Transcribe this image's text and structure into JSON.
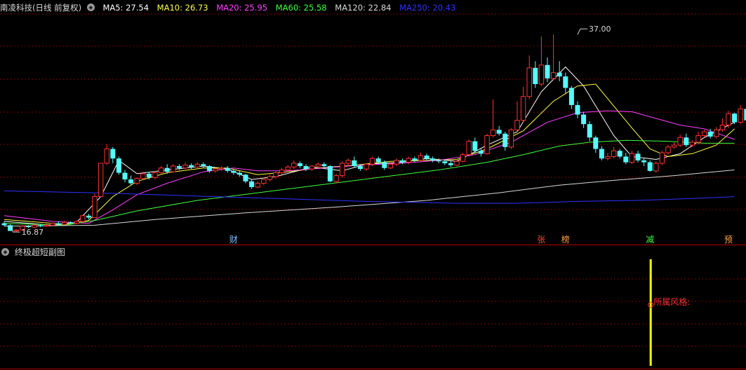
{
  "header": {
    "stock_title": "南凌科技(日线 前复权)",
    "ma": [
      {
        "label": "MA5: 27.54",
        "color": "#ffffff"
      },
      {
        "label": "MA10: 26.73",
        "color": "#ffff40"
      },
      {
        "label": "MA20: 25.95",
        "color": "#ff40ff"
      },
      {
        "label": "MA60: 25.58",
        "color": "#40ff40"
      },
      {
        "label": "MA120: 22.84",
        "color": "#d8d8d8"
      },
      {
        "label": "MA250: 20.43",
        "color": "#3030ff"
      }
    ]
  },
  "subchart": {
    "title": "终极超短副图",
    "style_label": "所属风格:"
  },
  "colors": {
    "up": "#ff3232",
    "down": "#54ffff",
    "grid": "#800000",
    "yellow_bar": "#ffff00",
    "style_text": "#ff3030"
  },
  "markers": [
    {
      "label": "财",
      "index": 38,
      "color": "#7ec0ff"
    },
    {
      "label": "张",
      "index": 89,
      "color": "#ff4040"
    },
    {
      "label": "榜",
      "index": 93,
      "color": "#ffa040"
    },
    {
      "label": "减",
      "index": 107,
      "color": "#40ff40"
    },
    {
      "label": "预",
      "index": 120,
      "color": "#ffa040"
    }
  ],
  "chart_data": {
    "type": "candlestick",
    "price_annotations": [
      {
        "label": "37.00",
        "value": 37.0,
        "index": 95
      },
      {
        "label": "16.87",
        "value": 16.87,
        "index": 1
      }
    ],
    "candles": [
      [
        17.2,
        17.0,
        17.4,
        16.9
      ],
      [
        17.0,
        16.4,
        17.1,
        16.4
      ],
      [
        16.4,
        16.5,
        16.6,
        16.3
      ],
      [
        16.5,
        16.9,
        17.0,
        16.4
      ],
      [
        16.9,
        16.8,
        17.0,
        16.7
      ],
      [
        16.8,
        17.0,
        17.1,
        16.7
      ],
      [
        17.0,
        16.9,
        17.1,
        16.8
      ],
      [
        16.9,
        17.0,
        17.2,
        16.8
      ],
      [
        17.0,
        17.2,
        17.3,
        16.9
      ],
      [
        17.2,
        17.1,
        17.4,
        17.0
      ],
      [
        17.1,
        17.3,
        17.5,
        17.0
      ],
      [
        17.3,
        17.2,
        17.4,
        17.1
      ],
      [
        17.2,
        17.4,
        17.5,
        17.1
      ],
      [
        17.4,
        18.0,
        18.1,
        17.3
      ],
      [
        18.0,
        17.8,
        18.2,
        17.6
      ],
      [
        17.8,
        20.0,
        20.3,
        17.8
      ],
      [
        20.0,
        23.5,
        23.5,
        20.0
      ],
      [
        23.5,
        25.0,
        25.5,
        23.3
      ],
      [
        25.0,
        24.0,
        25.2,
        23.5
      ],
      [
        24.0,
        22.5,
        24.2,
        22.3
      ],
      [
        22.5,
        21.8,
        22.8,
        21.5
      ],
      [
        21.8,
        21.4,
        22.2,
        21.2
      ],
      [
        21.4,
        21.9,
        22.0,
        21.2
      ],
      [
        21.9,
        22.4,
        22.6,
        21.7
      ],
      [
        22.4,
        22.0,
        22.6,
        21.8
      ],
      [
        22.0,
        22.5,
        22.7,
        21.8
      ],
      [
        22.5,
        23.0,
        23.2,
        22.3
      ],
      [
        23.0,
        22.6,
        23.4,
        22.4
      ],
      [
        22.6,
        23.2,
        23.4,
        22.5
      ],
      [
        23.2,
        23.0,
        23.4,
        22.8
      ],
      [
        23.0,
        23.3,
        23.6,
        22.9
      ],
      [
        23.3,
        23.1,
        23.5,
        22.9
      ],
      [
        23.1,
        23.4,
        23.6,
        23.0
      ],
      [
        23.4,
        23.2,
        23.6,
        23.0
      ],
      [
        23.2,
        22.7,
        23.3,
        22.5
      ],
      [
        22.7,
        22.9,
        23.0,
        22.5
      ],
      [
        22.9,
        23.0,
        23.2,
        22.7
      ],
      [
        23.0,
        22.7,
        23.2,
        22.5
      ],
      [
        22.7,
        22.5,
        22.9,
        22.3
      ],
      [
        22.5,
        22.3,
        22.7,
        22.1
      ],
      [
        22.3,
        21.6,
        22.4,
        21.4
      ],
      [
        21.6,
        21.0,
        21.8,
        20.8
      ],
      [
        21.0,
        21.4,
        21.6,
        20.9
      ],
      [
        21.4,
        21.8,
        22.0,
        21.2
      ],
      [
        21.8,
        22.1,
        22.3,
        21.6
      ],
      [
        22.1,
        22.5,
        22.7,
        21.9
      ],
      [
        22.5,
        22.8,
        23.0,
        22.3
      ],
      [
        22.8,
        23.1,
        23.3,
        22.6
      ],
      [
        23.1,
        23.5,
        23.8,
        22.9
      ],
      [
        23.5,
        23.2,
        23.7,
        23.0
      ],
      [
        23.2,
        22.9,
        23.4,
        22.7
      ],
      [
        22.9,
        23.2,
        23.3,
        22.7
      ],
      [
        23.2,
        23.4,
        23.6,
        23.0
      ],
      [
        23.4,
        23.2,
        23.6,
        23.0
      ],
      [
        23.2,
        21.6,
        23.3,
        21.5
      ],
      [
        21.6,
        22.2,
        22.4,
        21.4
      ],
      [
        22.2,
        23.5,
        23.7,
        22.0
      ],
      [
        23.5,
        23.8,
        24.0,
        23.2
      ],
      [
        23.8,
        23.2,
        24.2,
        23.0
      ],
      [
        23.2,
        22.9,
        23.4,
        22.7
      ],
      [
        22.9,
        23.4,
        23.5,
        22.7
      ],
      [
        23.4,
        24.0,
        24.2,
        23.2
      ],
      [
        24.0,
        23.6,
        24.2,
        23.4
      ],
      [
        23.6,
        23.0,
        23.8,
        22.8
      ],
      [
        23.0,
        23.4,
        23.6,
        22.9
      ],
      [
        23.4,
        23.8,
        24.0,
        23.2
      ],
      [
        23.8,
        23.6,
        24.0,
        23.4
      ],
      [
        23.6,
        24.0,
        24.2,
        23.4
      ],
      [
        24.0,
        23.8,
        24.2,
        23.6
      ],
      [
        23.8,
        24.3,
        24.6,
        23.7
      ],
      [
        24.3,
        24.0,
        24.5,
        23.8
      ],
      [
        24.0,
        23.8,
        24.2,
        23.6
      ],
      [
        23.8,
        23.7,
        24.0,
        23.5
      ],
      [
        23.7,
        23.5,
        23.9,
        23.3
      ],
      [
        23.5,
        23.3,
        23.7,
        23.1
      ],
      [
        23.3,
        23.7,
        23.9,
        23.2
      ],
      [
        23.7,
        24.4,
        24.6,
        23.6
      ],
      [
        24.4,
        25.8,
        26.0,
        24.2
      ],
      [
        25.8,
        24.8,
        26.2,
        24.6
      ],
      [
        24.8,
        24.5,
        25.0,
        24.2
      ],
      [
        24.5,
        26.4,
        26.6,
        24.4
      ],
      [
        26.4,
        27.0,
        30.2,
        26.2
      ],
      [
        27.0,
        26.6,
        27.4,
        26.4
      ],
      [
        26.6,
        25.2,
        26.8,
        24.8
      ],
      [
        25.2,
        27.0,
        27.2,
        25.0
      ],
      [
        27.0,
        28.0,
        30.0,
        26.8
      ],
      [
        28.0,
        30.5,
        31.5,
        27.8
      ],
      [
        30.5,
        33.5,
        34.8,
        30.2
      ],
      [
        33.5,
        31.8,
        34.2,
        31.4
      ],
      [
        31.8,
        33.8,
        36.8,
        31.6
      ],
      [
        33.8,
        32.4,
        34.6,
        32.0
      ],
      [
        32.4,
        33.0,
        37.0,
        32.2
      ],
      [
        33.0,
        32.6,
        34.2,
        32.1
      ],
      [
        32.6,
        31.4,
        33.0,
        30.8
      ],
      [
        31.4,
        29.6,
        31.6,
        29.2
      ],
      [
        29.6,
        28.6,
        30.0,
        28.2
      ],
      [
        28.6,
        27.6,
        28.9,
        27.2
      ],
      [
        27.6,
        26.2,
        27.9,
        25.8
      ],
      [
        26.2,
        25.0,
        26.4,
        24.6
      ],
      [
        25.0,
        24.0,
        25.3,
        23.8
      ],
      [
        24.0,
        24.2,
        24.6,
        23.8
      ],
      [
        24.2,
        24.8,
        25.2,
        24.0
      ],
      [
        24.8,
        24.2,
        25.0,
        24.0
      ],
      [
        24.2,
        23.6,
        24.6,
        23.4
      ],
      [
        23.6,
        24.5,
        24.8,
        23.4
      ],
      [
        24.5,
        23.8,
        24.8,
        23.6
      ],
      [
        23.8,
        23.6,
        24.0,
        23.2
      ],
      [
        23.6,
        22.7,
        23.8,
        22.6
      ],
      [
        22.7,
        23.5,
        23.7,
        22.5
      ],
      [
        23.5,
        24.6,
        24.8,
        23.3
      ],
      [
        24.6,
        25.2,
        25.4,
        24.4
      ],
      [
        25.2,
        25.4,
        25.7,
        25.0
      ],
      [
        25.4,
        26.2,
        26.5,
        25.2
      ],
      [
        26.2,
        25.4,
        26.6,
        25.2
      ],
      [
        25.4,
        25.7,
        25.9,
        25.2
      ],
      [
        25.7,
        26.4,
        26.8,
        25.5
      ],
      [
        26.4,
        26.8,
        27.0,
        26.2
      ],
      [
        26.8,
        26.3,
        27.1,
        26.1
      ],
      [
        26.3,
        27.0,
        27.3,
        26.1
      ],
      [
        27.0,
        27.5,
        28.2,
        26.8
      ],
      [
        27.5,
        28.7,
        29.0,
        27.2
      ],
      [
        28.7,
        27.8,
        28.8,
        27.6
      ],
      [
        27.8,
        29.2,
        29.6,
        27.6
      ],
      [
        29.2,
        28.0,
        29.3,
        27.8
      ]
    ],
    "ma_series": [
      {
        "name": "MA5",
        "color": "#ffffff",
        "points": [
          [
            0,
            17.4
          ],
          [
            8,
            17.0
          ],
          [
            12,
            17.3
          ],
          [
            16,
            20.0
          ],
          [
            19,
            23.8
          ],
          [
            22,
            22.4
          ],
          [
            27,
            22.8
          ],
          [
            33,
            23.2
          ],
          [
            37,
            22.9
          ],
          [
            41,
            21.8
          ],
          [
            45,
            22.1
          ],
          [
            51,
            23.1
          ],
          [
            56,
            22.7
          ],
          [
            60,
            23.4
          ],
          [
            66,
            23.6
          ],
          [
            70,
            24.0
          ],
          [
            75,
            23.7
          ],
          [
            80,
            25.4
          ],
          [
            85,
            26.8
          ],
          [
            89,
            31.0
          ],
          [
            93,
            33.6
          ],
          [
            96,
            31.6
          ],
          [
            101,
            26.4
          ],
          [
            104,
            24.2
          ],
          [
            108,
            23.9
          ],
          [
            112,
            24.5
          ],
          [
            116,
            26.2
          ],
          [
            121,
            27.8
          ]
        ]
      },
      {
        "name": "MA10",
        "color": "#ffff40",
        "points": [
          [
            0,
            17.6
          ],
          [
            10,
            17.1
          ],
          [
            14,
            17.5
          ],
          [
            18,
            20.0
          ],
          [
            22,
            21.6
          ],
          [
            27,
            22.5
          ],
          [
            33,
            23.0
          ],
          [
            37,
            23.0
          ],
          [
            42,
            22.3
          ],
          [
            47,
            22.6
          ],
          [
            52,
            23.0
          ],
          [
            58,
            23.3
          ],
          [
            64,
            23.7
          ],
          [
            70,
            23.8
          ],
          [
            75,
            23.9
          ],
          [
            80,
            25.0
          ],
          [
            86,
            26.9
          ],
          [
            91,
            30.0
          ],
          [
            95,
            31.6
          ],
          [
            98,
            31.8
          ],
          [
            101,
            29.5
          ],
          [
            104,
            27.2
          ],
          [
            107,
            25.0
          ],
          [
            110,
            24.2
          ],
          [
            114,
            24.5
          ],
          [
            118,
            25.4
          ],
          [
            121,
            27.1
          ]
        ]
      },
      {
        "name": "MA20",
        "color": "#ff40ff",
        "points": [
          [
            0,
            18.0
          ],
          [
            8,
            17.4
          ],
          [
            14,
            17.2
          ],
          [
            18,
            18.6
          ],
          [
            22,
            20.2
          ],
          [
            27,
            21.4
          ],
          [
            33,
            22.6
          ],
          [
            38,
            23.0
          ],
          [
            42,
            22.7
          ],
          [
            47,
            22.7
          ],
          [
            53,
            23.0
          ],
          [
            59,
            23.3
          ],
          [
            66,
            23.5
          ],
          [
            72,
            23.8
          ],
          [
            78,
            24.4
          ],
          [
            84,
            25.7
          ],
          [
            90,
            27.8
          ],
          [
            95,
            28.8
          ],
          [
            100,
            29.0
          ],
          [
            104,
            28.9
          ],
          [
            108,
            28.2
          ],
          [
            112,
            27.5
          ],
          [
            116,
            27.1
          ],
          [
            121,
            26.0
          ]
        ]
      },
      {
        "name": "MA60",
        "color": "#40ff40",
        "points": [
          [
            0,
            17.2
          ],
          [
            10,
            17.0
          ],
          [
            15,
            17.5
          ],
          [
            22,
            18.5
          ],
          [
            32,
            19.6
          ],
          [
            42,
            20.4
          ],
          [
            52,
            21.2
          ],
          [
            62,
            22.0
          ],
          [
            72,
            22.8
          ],
          [
            80,
            23.6
          ],
          [
            86,
            24.4
          ],
          [
            92,
            25.3
          ],
          [
            97,
            25.7
          ],
          [
            103,
            25.9
          ],
          [
            110,
            25.8
          ],
          [
            116,
            25.6
          ],
          [
            121,
            25.6
          ]
        ]
      },
      {
        "name": "MA120",
        "color": "#d8d8d8",
        "points": [
          [
            0,
            16.9
          ],
          [
            15,
            17.0
          ],
          [
            25,
            17.6
          ],
          [
            40,
            18.3
          ],
          [
            55,
            18.9
          ],
          [
            70,
            19.6
          ],
          [
            82,
            20.4
          ],
          [
            92,
            21.2
          ],
          [
            101,
            21.7
          ],
          [
            111,
            22.2
          ],
          [
            121,
            22.8
          ]
        ]
      },
      {
        "name": "MA250",
        "color": "#3030ff",
        "points": [
          [
            0,
            20.6
          ],
          [
            15,
            20.4
          ],
          [
            30,
            20.1
          ],
          [
            45,
            19.8
          ],
          [
            60,
            19.5
          ],
          [
            75,
            19.3
          ],
          [
            85,
            19.3
          ],
          [
            95,
            19.5
          ],
          [
            105,
            19.6
          ],
          [
            114,
            19.8
          ],
          [
            121,
            20.0
          ]
        ]
      }
    ],
    "price_range": [
      16.0,
      39.0
    ],
    "subchart_bar": {
      "index": 107,
      "value": 1.0
    }
  }
}
